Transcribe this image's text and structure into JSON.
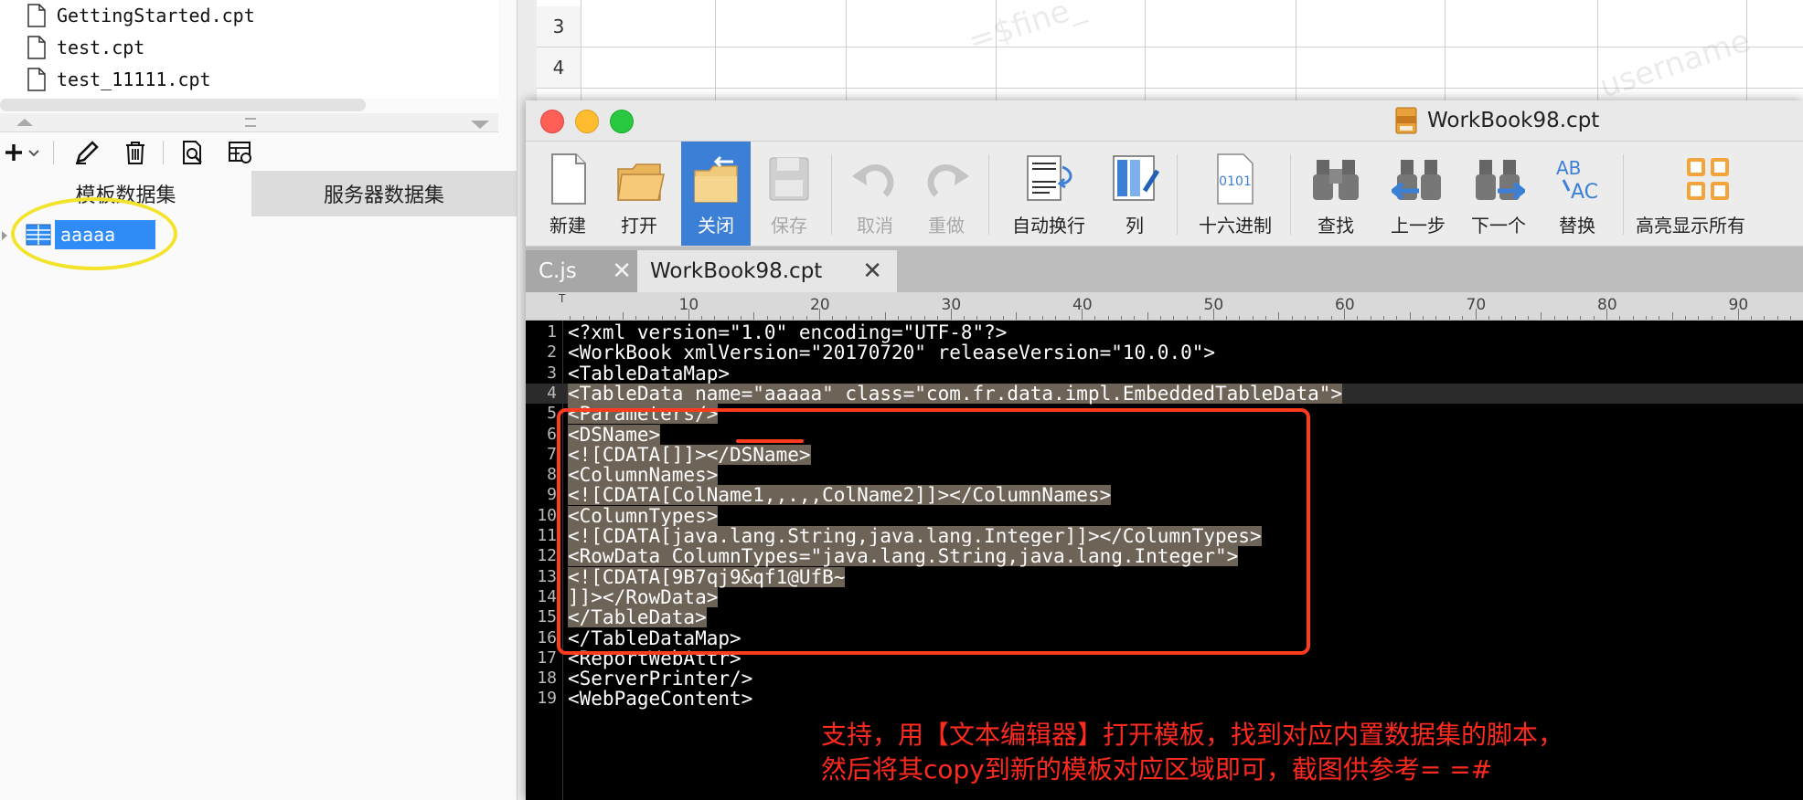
{
  "file_list": {
    "items": [
      "GettingStarted.cpt",
      "test.cpt",
      "test_11111.cpt"
    ]
  },
  "ds_panel": {
    "tabs": [
      "模板数据集",
      "服务器数据集"
    ],
    "tree_item": "aaaaa"
  },
  "sheet": {
    "rows": [
      "3",
      "4"
    ],
    "watermarks": [
      "=$fine_",
      "username"
    ]
  },
  "editor": {
    "title": "WorkBook98.cpt",
    "toolbar": [
      {
        "label": "新建",
        "icon": "new-file-icon",
        "state": "normal"
      },
      {
        "label": "打开",
        "icon": "open-folder-icon",
        "state": "normal"
      },
      {
        "label": "关闭",
        "icon": "close-folder-icon",
        "state": "active"
      },
      {
        "label": "保存",
        "icon": "save-icon",
        "state": "disabled"
      },
      {
        "label": "取消",
        "icon": "undo-icon",
        "state": "disabled"
      },
      {
        "label": "重做",
        "icon": "redo-icon",
        "state": "disabled"
      },
      {
        "label": "自动换行",
        "icon": "word-wrap-icon",
        "state": "normal"
      },
      {
        "label": "列",
        "icon": "column-edit-icon",
        "state": "normal"
      },
      {
        "label": "十六进制",
        "icon": "hex-file-icon",
        "state": "normal"
      },
      {
        "label": "查找",
        "icon": "binoculars-icon",
        "state": "normal"
      },
      {
        "label": "上一步",
        "icon": "find-previous-icon",
        "state": "normal"
      },
      {
        "label": "下一个",
        "icon": "find-next-icon",
        "state": "normal"
      },
      {
        "label": "替换",
        "icon": "replace-icon",
        "state": "normal"
      },
      {
        "label": "高亮显示所有",
        "icon": "highlight-all-icon",
        "state": "normal"
      }
    ],
    "hex_icon_text": "0101",
    "replace_icon_text": [
      "AB",
      "AC"
    ],
    "tabs": [
      {
        "label": "C.js",
        "active": false
      },
      {
        "label": "WorkBook98.cpt",
        "active": true
      }
    ],
    "ruler_marks": [
      "10",
      "20",
      "30",
      "40",
      "50",
      "60",
      "70",
      "80",
      "90"
    ],
    "ruler_prefix": "T",
    "lines": [
      {
        "n": "1",
        "text": "<?xml version=\"1.0\" encoding=\"UTF-8\"?>",
        "selected": false
      },
      {
        "n": "2",
        "text": "<WorkBook xmlVersion=\"20170720\" releaseVersion=\"10.0.0\">",
        "selected": false
      },
      {
        "n": "3",
        "text": "<TableDataMap>",
        "selected": false
      },
      {
        "n": "4",
        "text": "<TableData name=\"aaaaa\" class=\"com.fr.data.impl.EmbeddedTableData\">",
        "selected": true
      },
      {
        "n": "5",
        "text": "<Parameters/>",
        "selected": true
      },
      {
        "n": "6",
        "text": "<DSName>",
        "selected": true
      },
      {
        "n": "7",
        "text": "<![CDATA[]]></DSName>",
        "selected": true
      },
      {
        "n": "8",
        "text": "<ColumnNames>",
        "selected": true
      },
      {
        "n": "9",
        "text": "<![CDATA[ColName1,,.,,ColName2]]></ColumnNames>",
        "selected": true
      },
      {
        "n": "10",
        "text": "<ColumnTypes>",
        "selected": true
      },
      {
        "n": "11",
        "text": "<![CDATA[java.lang.String,java.lang.Integer]]></ColumnTypes>",
        "selected": true
      },
      {
        "n": "12",
        "text": "<RowData ColumnTypes=\"java.lang.String,java.lang.Integer\">",
        "selected": true
      },
      {
        "n": "13",
        "text": "<![CDATA[9B7qj9&qf1@UfB~",
        "selected": true
      },
      {
        "n": "14",
        "text": "]]></RowData>",
        "selected": true
      },
      {
        "n": "15",
        "text": "</TableData>",
        "selected": true
      },
      {
        "n": "16",
        "text": "</TableDataMap>",
        "selected": false
      },
      {
        "n": "17",
        "text": "<ReportWebAttr>",
        "selected": false
      },
      {
        "n": "18",
        "text": "<ServerPrinter/>",
        "selected": false
      },
      {
        "n": "19",
        "text": "<WebPageContent>",
        "selected": false
      }
    ]
  },
  "annotation": {
    "line1": "支持，用【文本编辑器】打开模板，找到对应内置数据集的脚本，",
    "line2": "然后将其copy到新的模板对应区域即可，截图供参考= =#"
  },
  "colors": {
    "selection_blue": "#2f8cf6",
    "highlight_yellow": "#f3e32b",
    "annotation_red": "#ff3b1f",
    "code_selection": "#6e6357"
  }
}
